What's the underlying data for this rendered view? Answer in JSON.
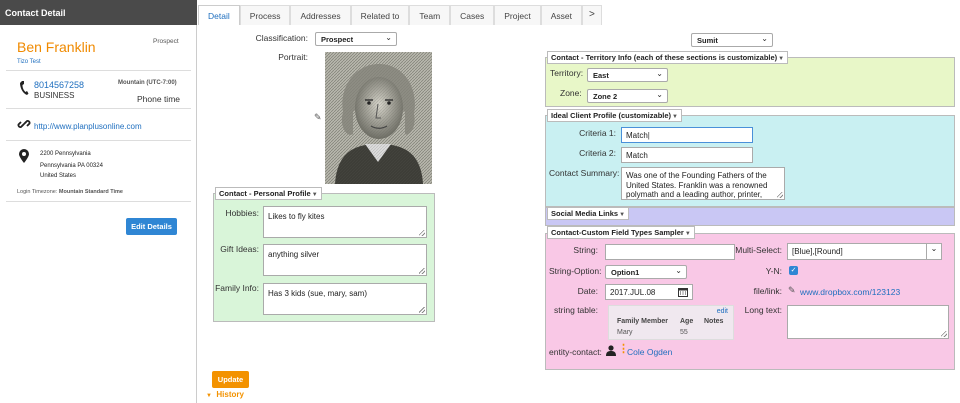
{
  "panel": {
    "title": "Contact Detail",
    "name": "Ben Franklin",
    "status": "Prospect",
    "company": "Tizo Test",
    "phone": "8014567258",
    "phone_type": "BUSINESS",
    "timezone": "Mountain (UTC-7:00)",
    "phone_time_label": "Phone time",
    "website": "http://www.planplusonline.com",
    "address_line1": "2200 Pennsylvania",
    "address_line2": "Pennsylvania PA 00324",
    "address_line3": "United States",
    "login_tz_label": "Login Timezone:",
    "login_tz_value": "Mountain Standard Time",
    "edit_button": "Edit Details"
  },
  "tabs": [
    "Detail",
    "Process",
    "Addresses",
    "Related to",
    "Team",
    "Cases",
    "Project",
    "Asset",
    ">"
  ],
  "form": {
    "classification_label": "Classification:",
    "classification_value": "Prospect",
    "portrait_label": "Portrait:",
    "team_lead_label": "Team Lead:",
    "team_lead_value": "Sumit"
  },
  "personal": {
    "title": "Contact - Personal Profile",
    "hobbies_label": "Hobbies:",
    "hobbies_value": "Likes to fly kites",
    "gift_label": "Gift Ideas:",
    "gift_value": "anything silver",
    "family_label": "Family Info:",
    "family_value": "Has 3 kids (sue, mary, sam)"
  },
  "territory": {
    "title": "Contact - Territory Info (each of these sections is customizable)",
    "territory_label": "Territory:",
    "territory_value": "East",
    "zone_label": "Zone:",
    "zone_value": "Zone 2"
  },
  "ideal": {
    "title": "Ideal Client Profile (customizable)",
    "criteria1_label": "Criteria 1:",
    "criteria1_value": "Match",
    "criteria2_label": "Criteria 2:",
    "criteria2_value": "Match",
    "summary_label": "Contact Summary:",
    "summary_value": "Was one of the Founding Fathers of the United States. Franklin was a renowned polymath and a leading author, printer,"
  },
  "social": {
    "title": "Social Media Links"
  },
  "custom": {
    "title": "Contact-Custom Field Types Sampler",
    "string_label": "String:",
    "string_value": "",
    "string_option_label": "String-Option:",
    "string_option_value": "Option1",
    "date_label": "Date:",
    "date_value": "2017.JUL.08",
    "string_table_label": "string table:",
    "table_edit": "edit",
    "table_headers": [
      "Family Member",
      "Age",
      "Notes"
    ],
    "table_rows": [
      [
        "Mary",
        "55",
        ""
      ]
    ],
    "entity_label": "entity-contact:",
    "entity_value": "Cole Ogden",
    "multi_label": "Multi-Select:",
    "multi_value": "[Blue],[Round]",
    "yn_label": "Y-N:",
    "file_label": "file/link:",
    "file_value": "www.dropbox.com/123123",
    "long_label": "Long text:",
    "long_value": ""
  },
  "footer": {
    "update_button": "Update",
    "history_label": "History"
  },
  "colors": {
    "personal_bg": "#d9f5d9",
    "territory_bg": "#e8f7c8",
    "ideal_bg": "#c9f0f2",
    "social_bg": "#c9c7f4",
    "custom_bg": "#f9c8e6",
    "accent_orange": "#f39200",
    "accent_blue": "#2f86d4"
  }
}
